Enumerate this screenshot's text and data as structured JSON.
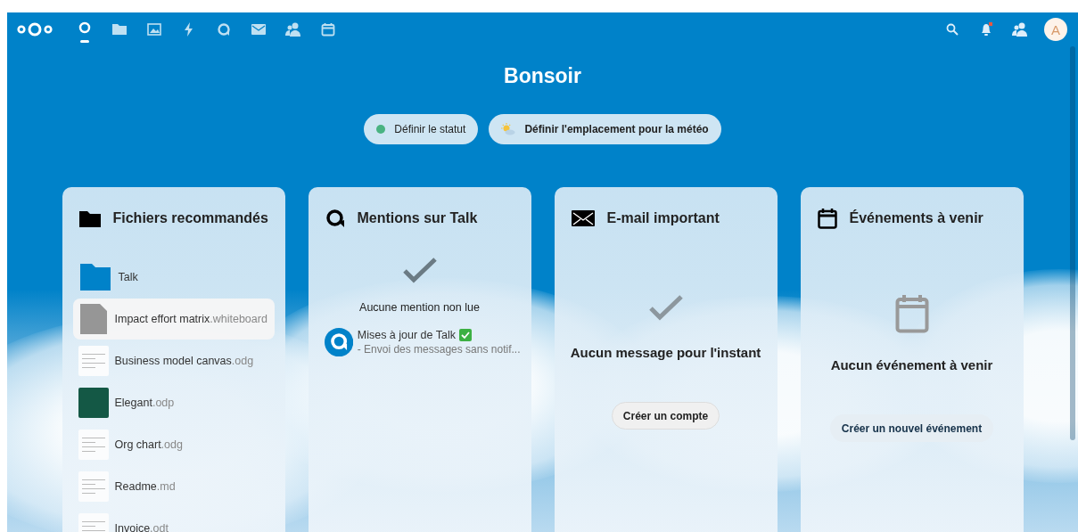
{
  "header": {
    "apps": [
      {
        "kind": "dashboard",
        "selected": true
      },
      {
        "kind": "files",
        "selected": false
      },
      {
        "kind": "photos",
        "selected": false
      },
      {
        "kind": "activity",
        "selected": false
      },
      {
        "kind": "talk",
        "selected": false
      },
      {
        "kind": "mail",
        "selected": false
      },
      {
        "kind": "contacts",
        "selected": false
      },
      {
        "kind": "calendar",
        "selected": false
      }
    ],
    "notifications_unread": true,
    "avatar_initial": "A"
  },
  "greeting": "Bonsoir",
  "actions": [
    {
      "kind": "status",
      "label": "Définir le statut",
      "color": "#49b382"
    },
    {
      "kind": "weather",
      "label": "Définir l'emplacement pour la météo"
    }
  ],
  "widgets": [
    {
      "kind": "files",
      "title": "Fichiers recommandés",
      "items": [
        {
          "kind": "folder",
          "name": "Talk",
          "selected": false
        },
        {
          "kind": "blank",
          "name": "Impact effort matrix",
          "ext": ".whiteboard",
          "selected": true
        },
        {
          "kind": "light-thumb",
          "name": "Business model canvas",
          "ext": ".odg",
          "selected": false
        },
        {
          "kind": "dark-thumb",
          "name": "Elegant",
          "ext": ".odp",
          "selected": false
        },
        {
          "kind": "light-thumb",
          "name": "Org chart",
          "ext": ".odg",
          "selected": false
        },
        {
          "kind": "light-thumb",
          "name": "Readme",
          "ext": ".md",
          "selected": false
        },
        {
          "kind": "light-thumb",
          "name": "Invoice",
          "ext": ".odt",
          "selected": false
        }
      ]
    },
    {
      "kind": "talk",
      "title": "Mentions sur Talk",
      "empty_text": "Aucune mention non lue",
      "items": [
        {
          "title": "Mises à jour de Talk",
          "done": true,
          "subtitle": "- Envoi des messages sans notif..."
        }
      ]
    },
    {
      "kind": "mail",
      "title": "E-mail important",
      "empty_text": "Aucun message pour l'instant",
      "button": {
        "label": "Créer un compte"
      }
    },
    {
      "kind": "calendar",
      "title": "Événements à venir",
      "empty_text": "Aucun événement à venir",
      "button": {
        "label": "Créer un nouvel événement"
      }
    }
  ]
}
